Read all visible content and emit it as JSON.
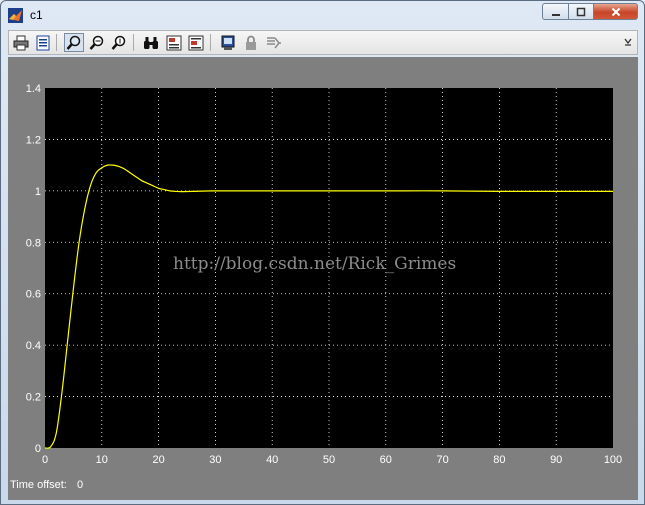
{
  "window": {
    "title": "c1",
    "icon": "matlab-logo-icon",
    "controls": {
      "minimize_icon": "minimize-icon",
      "maximize_icon": "maximize-icon",
      "close_icon": "close-icon"
    }
  },
  "toolbar": {
    "items": [
      {
        "name": "print",
        "icon": "printer-icon"
      },
      {
        "name": "parameters",
        "icon": "parameters-icon"
      },
      {
        "name": "zoom",
        "icon": "zoom-icon",
        "active": true
      },
      {
        "name": "zoom-x",
        "icon": "zoom-x-axis-icon"
      },
      {
        "name": "zoom-y",
        "icon": "zoom-y-axis-icon"
      },
      {
        "name": "autoscale",
        "icon": "binoculars-icon"
      },
      {
        "name": "save-axes",
        "icon": "save-axes-settings-icon"
      },
      {
        "name": "restore-axes",
        "icon": "restore-axes-settings-icon"
      },
      {
        "name": "floating-scope",
        "icon": "floating-scope-icon"
      },
      {
        "name": "lock-axes",
        "icon": "lock-icon"
      },
      {
        "name": "signal-selection",
        "icon": "signal-selection-icon"
      }
    ]
  },
  "watermark": "http://blog.csdn.net/Rick_Grimes",
  "status": {
    "time_offset_label": "Time offset:",
    "time_offset_value": "0"
  },
  "colors": {
    "plot_background": "#000000",
    "trace": "#ffff00",
    "figure_background": "#7f7f7f",
    "grid": "#ffffff"
  },
  "chart_data": {
    "type": "line",
    "title": "",
    "xlabel": "",
    "ylabel": "",
    "xlim": [
      0,
      100
    ],
    "ylim": [
      0,
      1.4
    ],
    "xticks": [
      0,
      10,
      20,
      30,
      40,
      50,
      60,
      70,
      80,
      90,
      100
    ],
    "yticks": [
      0,
      0.2,
      0.4,
      0.6,
      0.8,
      1,
      1.2,
      1.4
    ],
    "xtick_labels": [
      "0",
      "10",
      "20",
      "30",
      "40",
      "50",
      "60",
      "70",
      "80",
      "90",
      "100"
    ],
    "ytick_labels": [
      "0",
      "0.2",
      "0.4",
      "0.6",
      "0.8",
      "1",
      "1.2",
      "1.4"
    ],
    "grid": true,
    "series": [
      {
        "x": [
          0,
          1,
          2,
          3,
          4,
          5,
          6,
          7,
          8,
          9,
          10,
          11,
          12,
          13,
          14,
          15,
          16,
          17,
          18,
          19,
          20,
          21,
          22,
          23,
          24,
          26,
          30,
          40,
          50,
          60,
          70,
          80,
          90,
          100
        ],
        "y": [
          0,
          0.005,
          0.06,
          0.22,
          0.42,
          0.62,
          0.8,
          0.93,
          1.02,
          1.07,
          1.09,
          1.1,
          1.1,
          1.095,
          1.085,
          1.07,
          1.055,
          1.04,
          1.03,
          1.02,
          1.01,
          1.005,
          1.0,
          0.998,
          0.997,
          0.998,
          1.0,
          1.0,
          1.0,
          1.0,
          1.0,
          0.998,
          0.998,
          0.998
        ]
      }
    ]
  }
}
